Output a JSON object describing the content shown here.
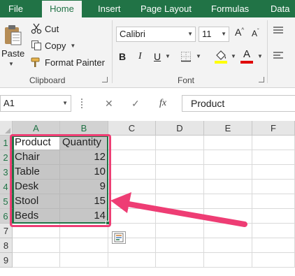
{
  "ribbon_tabs": [
    "File",
    "Home",
    "Insert",
    "Page Layout",
    "Formulas",
    "Data"
  ],
  "active_tab": "Home",
  "clipboard": {
    "paste_label": "Paste",
    "cut_label": "Cut",
    "copy_label": "Copy",
    "format_painter_label": "Format Painter",
    "group_label": "Clipboard"
  },
  "font": {
    "name": "Calibri",
    "size": "11",
    "bold_label": "B",
    "italic_label": "I",
    "underline_label": "U",
    "grow_label": "A",
    "shrink_label": "A",
    "font_color_label": "A",
    "group_label": "Font",
    "highlight_color": "#ffff00",
    "font_color": "#e00000"
  },
  "formula_bar": {
    "name_box": "A1",
    "cancel_icon": "x-icon",
    "enter_icon": "check-icon",
    "function_label": "fx",
    "value": "Product"
  },
  "columns": [
    "A",
    "B",
    "C",
    "D",
    "E",
    "F"
  ],
  "rows": [
    "1",
    "2",
    "3",
    "4",
    "5",
    "6",
    "7",
    "8",
    "9"
  ],
  "table": {
    "headers": [
      "Product",
      "Quantity"
    ],
    "rows": [
      [
        "Chair",
        "12"
      ],
      [
        "Table",
        "10"
      ],
      [
        "Desk",
        "9"
      ],
      [
        "Stool",
        "15"
      ],
      [
        "Beds",
        "14"
      ]
    ]
  },
  "colors": {
    "excel_green": "#217346",
    "selection_fill": "#c6c6c6",
    "annotation_pink": "#ee3d74"
  }
}
